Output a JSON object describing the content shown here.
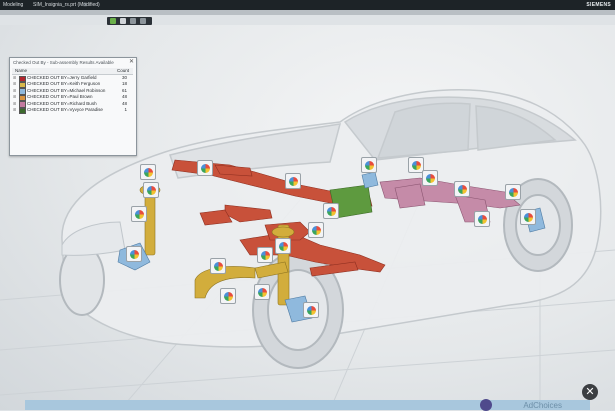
{
  "window": {
    "app_label": "Modeling",
    "file_title": "SIM_Insignia_rs.prt (Modified)",
    "file_suffix": "⊠",
    "brand": "SIEMENS"
  },
  "checkout_panel": {
    "title": "Checked Out By - Sub-assembly Results Available",
    "close": "✕",
    "headers": {
      "name": "Name",
      "count": "Count"
    },
    "rows": [
      {
        "expander": "⊞",
        "label": "CHECKED OUT BY=Jerry Garfield",
        "count": "30",
        "color": "#b3262e"
      },
      {
        "expander": "⊞",
        "label": "CHECKED OUT BY=Keith Ferguson",
        "count": "18",
        "color": "#d8b84a"
      },
      {
        "expander": "⊞",
        "label": "CHECKED OUT BY=Michael Robinson",
        "count": "61",
        "color": "#8fb9dd"
      },
      {
        "expander": "⊞",
        "label": "CHECKED OUT BY=Paul Brown",
        "count": "48",
        "color": "#d99440"
      },
      {
        "expander": "⊞",
        "label": "CHECKED OUT BY=Richard Bush",
        "count": "48",
        "color": "#c47aa0"
      },
      {
        "expander": "⊞",
        "label": "CHECKED OUT BY=Vyvyce Paradise",
        "count": "1",
        "color": "#3c6a2c"
      }
    ]
  },
  "overlay": {
    "close_icon": "✕",
    "ad_label": "AdChoices"
  },
  "colors": {
    "exhaust": "#c8513a",
    "suspension": "#d2ad3c",
    "rear_subframe": "#c58ba8",
    "battery": "#5e9a3f",
    "brake": "#8fb9dd"
  }
}
